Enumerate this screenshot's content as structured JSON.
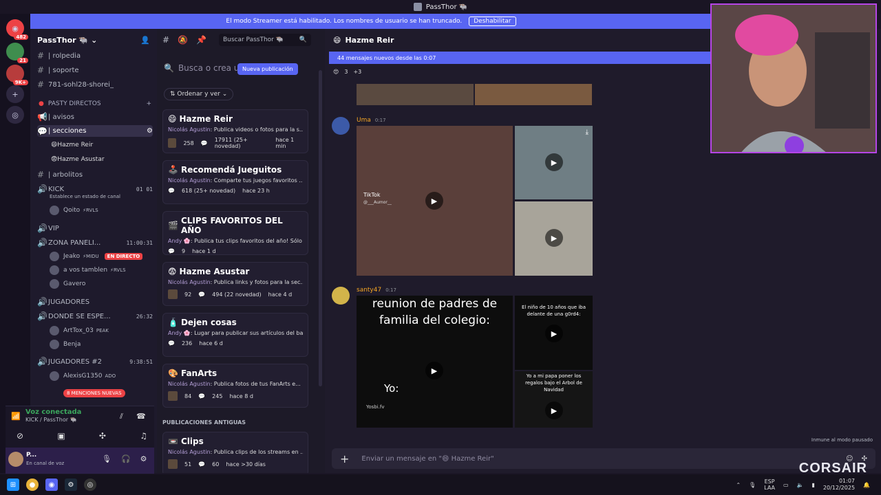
{
  "window": {
    "title": "PassThor 🐃"
  },
  "banner": {
    "text": "El modo Streamer está habilitado. Los nombres de usuario se han truncado.",
    "button": "Deshabilitar"
  },
  "rail": {
    "badges": [
      "482",
      "21",
      "9K+"
    ]
  },
  "server": {
    "name": "PassThor 🐃"
  },
  "channels": {
    "rolpedia": "| rolpedia",
    "soporte": "| soporte",
    "sohl": "781-sohl28-shorei_",
    "category_pasty": "PASTY DIRECTOS",
    "avisos": "| avisos",
    "secciones": "| secciones",
    "hazme_reir": "Hazme Reir",
    "hazme_asustar": "Hazme Asustar",
    "arbolitos": "| arbolitos",
    "kick": "KICK",
    "kick_counts": "01  01",
    "kick_status": "Establece un estado de canal",
    "kick_user": "Qoito",
    "kick_user_tag": "⚡RVLS",
    "vip": "VIP",
    "zona": "ZONA PANELI...",
    "zona_timer": "11:00:31",
    "zona_user1": "Jeako",
    "zona_user1_tag": "⚡MIDU",
    "live": "EN DIRECTO",
    "zona_user2": "a vos tamblen",
    "zona_user2_tag": "⚡RVLS",
    "zona_user3": "Gavero",
    "jugadores": "JUGADORES",
    "donde": "DONDE SE ESPE...",
    "donde_timer": "26:32",
    "donde_user1": "ArtTox_03",
    "donde_user1_tag": "PEAK",
    "donde_user2": "Benja",
    "jugadores2": "JUGADORES #2",
    "jugadores2_timer": "9:38:51",
    "jug2_user1": "AlexisG1350",
    "jug2_user1_tag": "ADO",
    "mentions": "8 MENCIONES NUEVAS"
  },
  "voice": {
    "title": "Voz conectada",
    "sub": "KICK / PassThor 🐃",
    "user": "P...",
    "status": "En canal de voz"
  },
  "forum": {
    "search": "Buscar PassThor 🐃",
    "find": "Busca o crea un",
    "new_post": "Nueva publicación",
    "sort": "Ordenar y ver",
    "old_header": "PUBLICACIONES ANTIGUAS",
    "posts": [
      {
        "emoji": "😄",
        "title": "Hazme Reir",
        "author": "Nicolás Agustin",
        "desc": ": Publica videos o fotos para la s...",
        "reactions": "258",
        "comments": "17911 (25+ novedad)",
        "time": "hace 1 min"
      },
      {
        "emoji": "🕹️",
        "title": "Recomendá Jueguitos",
        "author": "Nicolás Agustin",
        "desc": ": Comparte tus juegos favoritos ...",
        "reactions": "",
        "comments": "618 (25+ novedad)",
        "time": "hace 23 h"
      },
      {
        "emoji": "🎬",
        "title": "CLIPS FAVORITOS DEL AÑO",
        "author": "Andy 🌸",
        "desc": ": Publica tus clips favoritos del año! Sólo ...",
        "reactions": "",
        "comments": "9",
        "time": "hace 1 d"
      },
      {
        "emoji": "😨",
        "title": "Hazme Asustar",
        "author": "Nicolás Agustin",
        "desc": ": Publica links y fotos para la sec...",
        "reactions": "92",
        "comments": "494 (22 novedad)",
        "time": "hace 4 d"
      },
      {
        "emoji": "🧴",
        "title": "Dejen cosas",
        "author": "Andy 🌸",
        "desc": ": Lugar para publicar sus artículos del ba...",
        "reactions": "",
        "comments": "236",
        "time": "hace 6 d"
      },
      {
        "emoji": "🎨",
        "title": "FanArts",
        "author": "Nicolás Agustin",
        "desc": ": Publica fotos de tus FanArts e...",
        "reactions": "84",
        "comments": "245",
        "time": "hace 8 d"
      },
      {
        "emoji": "📼",
        "title": "Clips",
        "author": "Nicolás Agustin",
        "desc": ": Publica clips de los streams en ...",
        "reactions": "51",
        "comments": "60",
        "time": "hace >30 días"
      }
    ]
  },
  "chat": {
    "channel": "Hazme Reir",
    "new_messages": "44 mensajes nuevos desde las 0:07",
    "react_count": "3",
    "react_more": "+3",
    "msg1_author": "Uma",
    "msg1_time": "0:17",
    "tiktok": "TikTok",
    "tiktok_user": "@___Aumor__",
    "msg2_author": "santy47",
    "msg2_time": "0:17",
    "meme_top": "reunion de padres de familia del colegio:",
    "meme_yo": "Yo:",
    "meme_credit": "Yosbi.fv",
    "meme2_top": "El niño de 10 años que iba delante de una g0rd4:",
    "meme3_top": "Yo a mi papa poner los regalos bajo el Arbol de Navidad",
    "composer": "Enviar un mensaje en \"😄 Hazme Reir\"",
    "inmune": "Inmune al modo pausado"
  },
  "overlay": {
    "brand": "CORSAIR"
  },
  "tray": {
    "lang1": "ESP",
    "lang2": "LAA",
    "time": "01:07",
    "date": "20/12/2025"
  }
}
